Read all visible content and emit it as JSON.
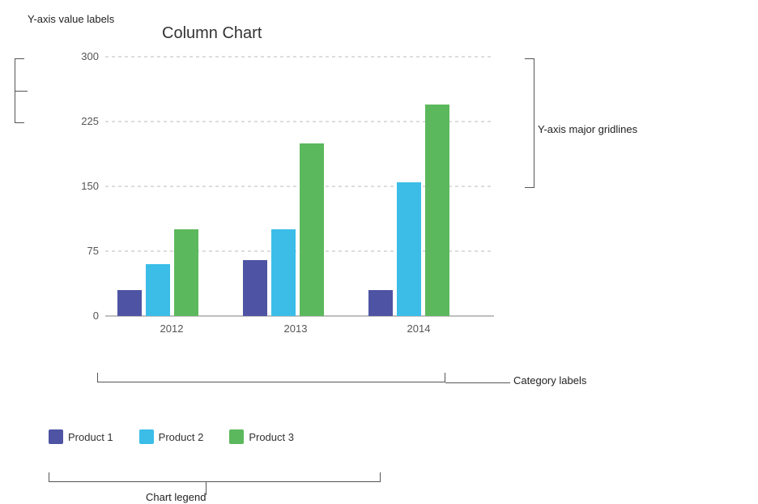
{
  "title": "Column Chart",
  "yAxis": {
    "labels": [
      "0",
      "75",
      "150",
      "225",
      "300"
    ],
    "values": [
      0,
      75,
      150,
      225,
      300
    ],
    "max": 300,
    "annotationLabel": "Y-axis value labels"
  },
  "xAxis": {
    "categories": [
      "2012",
      "2013",
      "2014"
    ],
    "annotationLabel": "Category labels"
  },
  "gridlines": {
    "annotationLabel": "Y-axis major gridlines"
  },
  "series": [
    {
      "name": "Product 1",
      "color": "#4e54a3",
      "values": [
        30,
        65,
        30
      ]
    },
    {
      "name": "Product 2",
      "color": "#3bbde8",
      "values": [
        60,
        100,
        155
      ]
    },
    {
      "name": "Product 3",
      "color": "#5cb85c",
      "values": [
        100,
        200,
        245
      ]
    }
  ],
  "legend": {
    "annotationLabel": "Chart legend",
    "items": [
      "Product 1",
      "Product 2",
      "Product 3"
    ]
  },
  "annotations": {
    "yAxisLabel": "Y-axis value labels",
    "gridlinesLabel": "Y-axis major gridlines",
    "categoryLabel": "Category labels",
    "legendLabel": "Chart legend"
  }
}
